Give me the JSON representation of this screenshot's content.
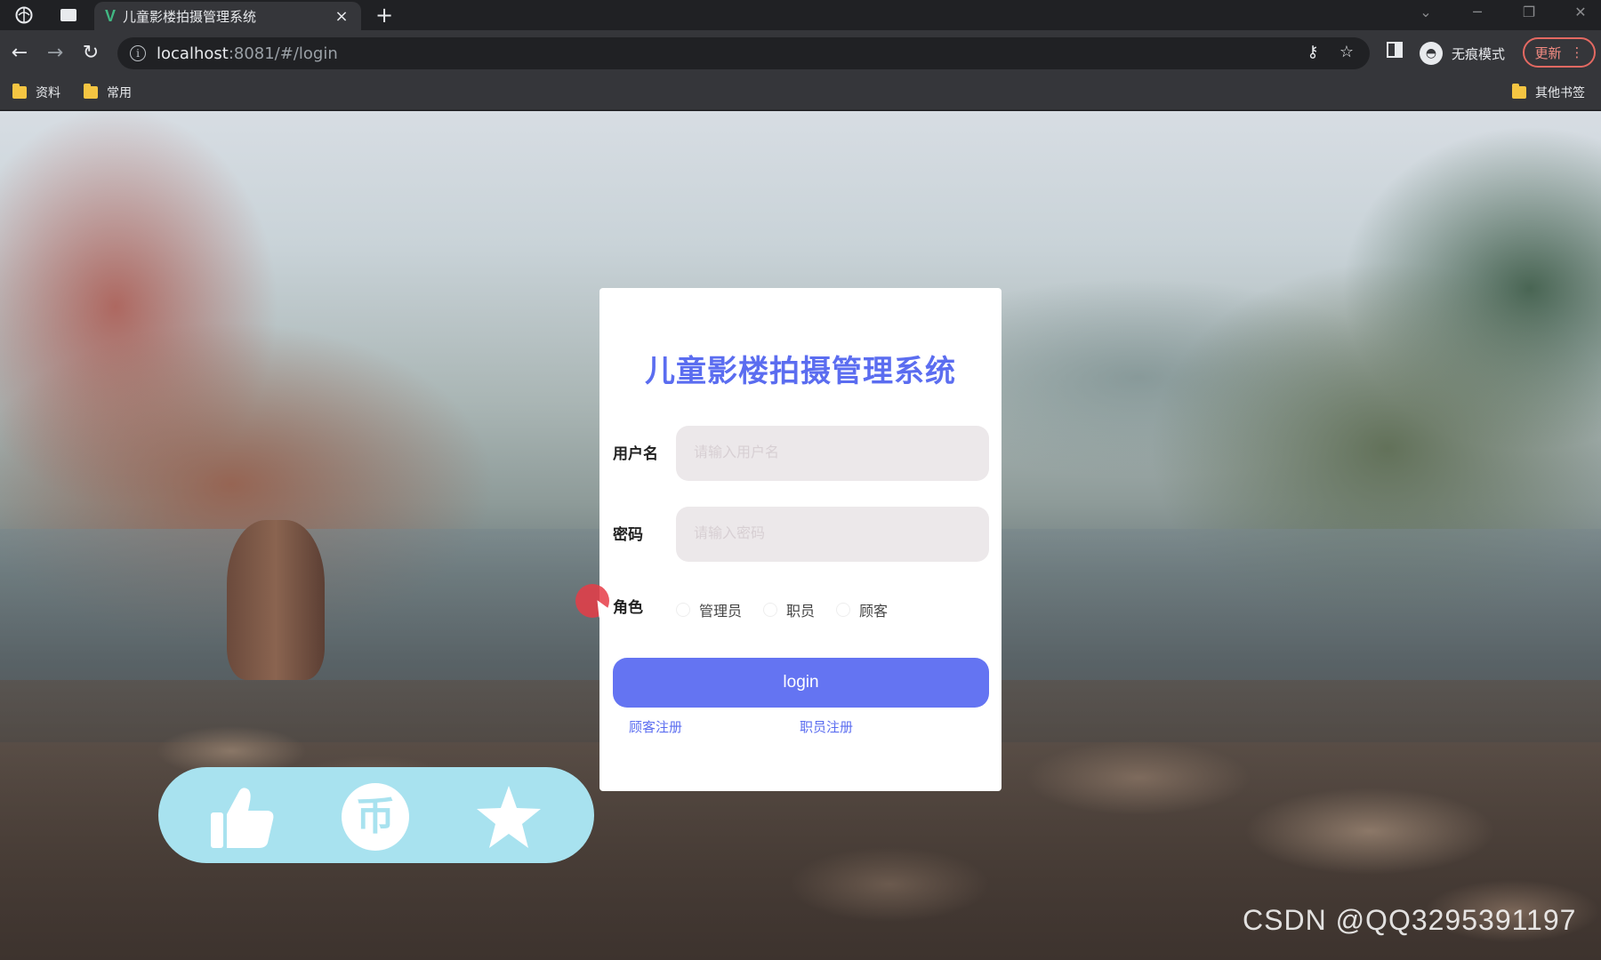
{
  "browser": {
    "tab_title": "儿童影楼拍摄管理系统",
    "tab_favicon": "V",
    "tab_close": "×",
    "new_tab": "+",
    "url_host": "localhost",
    "url_rest": ":8081/#/login",
    "incognito_label": "无痕模式",
    "update_label": "更新",
    "bookmarks": [
      {
        "label": "资料"
      },
      {
        "label": "常用"
      }
    ],
    "other_bookmarks": "其他书签"
  },
  "login": {
    "title": "儿童影楼拍摄管理系统",
    "username_label": "用户名",
    "username_placeholder": "请输入用户名",
    "password_label": "密码",
    "password_placeholder": "请输入密码",
    "role_label": "角色",
    "roles": [
      {
        "label": "管理员"
      },
      {
        "label": "职员"
      },
      {
        "label": "顾客"
      }
    ],
    "login_button": "login",
    "customer_register": "顾客注册",
    "staff_register": "职员注册",
    "accent_color": "#5b6df0",
    "button_color": "#6474f2"
  },
  "action_bar": {
    "coin_glyph": "币",
    "icons": [
      "thumbs-up-icon",
      "coin-icon",
      "star-icon"
    ],
    "color": "#a8e2ef"
  },
  "watermark": "CSDN @QQ3295391197"
}
